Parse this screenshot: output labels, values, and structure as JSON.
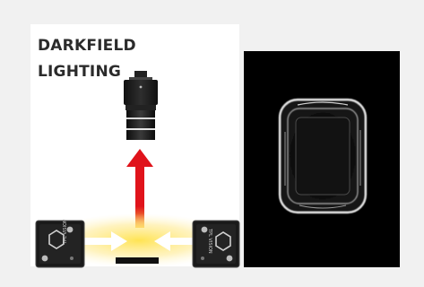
{
  "title": {
    "line1": "DARKFIELD",
    "line2": "LIGHTING"
  },
  "light_labels": {
    "left": "TPL VISION",
    "right": "TPL VISION"
  },
  "colors": {
    "background": "#f1f1f1",
    "panel": "#ffffff",
    "arrow_red": "#e0131b",
    "glow_yellow": "#ffe24a",
    "camera_dark": "#1c1c1c",
    "sample_view": "#000000"
  },
  "icons": [
    "camera-icon",
    "red-arrow-icon",
    "bar-light-left-icon",
    "bar-light-right-icon",
    "light-ray-arrow-icon"
  ]
}
